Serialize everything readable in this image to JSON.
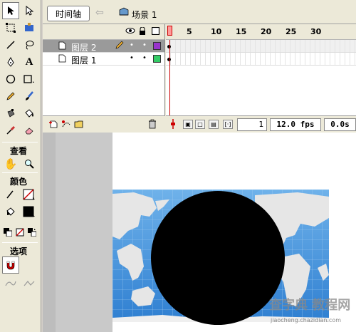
{
  "timeline": {
    "tab_label": "时间轴",
    "scene_label": "场景 1",
    "layers": [
      {
        "name": "图层 2",
        "selected": true,
        "color": "#9933cc"
      },
      {
        "name": "图层 1",
        "selected": false,
        "color": "#33cc66"
      }
    ],
    "ruler": [
      "1",
      "5",
      "10",
      "15",
      "20",
      "25",
      "30"
    ],
    "current_frame": "1",
    "fps": "12.0 fps",
    "elapsed": "0.0s"
  },
  "tools": {
    "section_view": "查看",
    "section_colors": "颜色",
    "section_options": "选项",
    "fill_color": "#000000"
  },
  "stage": {
    "circle_color": "#000000",
    "map_color": "#3f8fd8"
  },
  "watermark": {
    "logo": "查字典 教程网",
    "url": "jiaocheng.chazidian.com"
  }
}
